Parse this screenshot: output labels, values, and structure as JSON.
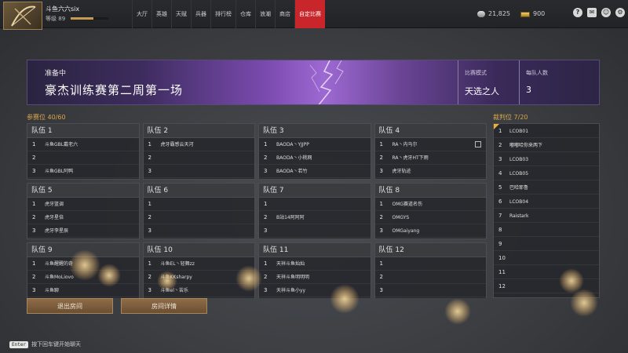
{
  "player": {
    "name": "斗鱼六六six",
    "level_label": "等级",
    "level_value": "89",
    "level_progress": 0.6
  },
  "nav": {
    "items": [
      "大厅",
      "英雄",
      "天赋",
      "兵器",
      "排行榜",
      "仓库",
      "浪潮",
      "商店",
      "自定比赛"
    ],
    "active_index": 8
  },
  "currency": {
    "silver": "21,825",
    "gold": "900"
  },
  "top_icons": [
    "help-icon",
    "mail-icon",
    "friends-icon",
    "settings-icon"
  ],
  "banner": {
    "status": "准备中",
    "title": "豪杰训练赛第二周第一场",
    "mode_label": "比赛模式",
    "mode_value": "天选之人",
    "team_size_label": "每队人数",
    "team_size_value": "3"
  },
  "participants": {
    "label": "参赛位",
    "count": "40/60"
  },
  "referees": {
    "label": "裁判位",
    "count": "7/20",
    "list": [
      {
        "num": "1",
        "name": "LCOB01"
      },
      {
        "num": "2",
        "name": "嘟嘟哈你来两下"
      },
      {
        "num": "3",
        "name": "LCOB03"
      },
      {
        "num": "4",
        "name": "LCOB05"
      },
      {
        "num": "5",
        "name": "巴哈耶鲁"
      },
      {
        "num": "6",
        "name": "LCOB04"
      },
      {
        "num": "7",
        "name": "Raistark"
      },
      {
        "num": "8",
        "name": ""
      },
      {
        "num": "9",
        "name": ""
      },
      {
        "num": "10",
        "name": ""
      },
      {
        "num": "11",
        "name": ""
      },
      {
        "num": "12",
        "name": ""
      }
    ]
  },
  "teams": [
    {
      "name": "队伍 1",
      "players": [
        {
          "num": "1",
          "name": "斗鱼GBL戴老六"
        },
        {
          "num": "2",
          "name": ""
        },
        {
          "num": "3",
          "name": "斗鱼GBL阿鸭"
        }
      ]
    },
    {
      "name": "队伍 2",
      "players": [
        {
          "num": "1",
          "name": "虎牙霸感云天河"
        },
        {
          "num": "2",
          "name": ""
        },
        {
          "num": "3",
          "name": ""
        }
      ]
    },
    {
      "name": "队伍 3",
      "players": [
        {
          "num": "1",
          "name": "BAODA丶YJJPP"
        },
        {
          "num": "2",
          "name": "BAODA丶小桃网"
        },
        {
          "num": "3",
          "name": "BAODA丶若竹"
        }
      ]
    },
    {
      "name": "队伍 4",
      "players": [
        {
          "num": "1",
          "name": "RA丶内马尔"
        },
        {
          "num": "2",
          "name": "RA丶虎牙HT下雨"
        },
        {
          "num": "3",
          "name": "虎牙轨迹"
        }
      ]
    },
    {
      "name": "队伍 5",
      "players": [
        {
          "num": "1",
          "name": "虎牙篮调"
        },
        {
          "num": "2",
          "name": "虎牙星倍"
        },
        {
          "num": "3",
          "name": "虎牙李星辰"
        }
      ]
    },
    {
      "name": "队伍 6",
      "players": [
        {
          "num": "1",
          "name": ""
        },
        {
          "num": "2",
          "name": ""
        },
        {
          "num": "3",
          "name": ""
        }
      ]
    },
    {
      "name": "队伍 7",
      "players": [
        {
          "num": "1",
          "name": ""
        },
        {
          "num": "2",
          "name": "B站14阿阿阿"
        },
        {
          "num": "3",
          "name": ""
        }
      ]
    },
    {
      "name": "队伍 8",
      "players": [
        {
          "num": "1",
          "name": "OMG赛道名伤"
        },
        {
          "num": "2",
          "name": "OMGYS"
        },
        {
          "num": "3",
          "name": "OMGaiyang"
        }
      ]
    },
    {
      "name": "队伍 9",
      "players": [
        {
          "num": "1",
          "name": "斗鱼醒醒的奇"
        },
        {
          "num": "2",
          "name": "斗鱼MoLiovo"
        },
        {
          "num": "3",
          "name": "斗鱼聊"
        }
      ]
    },
    {
      "name": "队伍 10",
      "players": [
        {
          "num": "1",
          "name": "斗鱼EL丶轻舞zz"
        },
        {
          "num": "2",
          "name": "斗鱼KKsharpy"
        },
        {
          "num": "3",
          "name": "斗鱼el丶苦乐"
        }
      ]
    },
    {
      "name": "队伍 11",
      "players": [
        {
          "num": "1",
          "name": "天祥斗鱼灿灿"
        },
        {
          "num": "2",
          "name": "天祥斗鱼明明明"
        },
        {
          "num": "3",
          "name": "天祥斗鱼小yy"
        }
      ]
    },
    {
      "name": "队伍 12",
      "players": [
        {
          "num": "1",
          "name": ""
        },
        {
          "num": "2",
          "name": ""
        },
        {
          "num": "3",
          "name": ""
        }
      ]
    }
  ],
  "buttons": {
    "exit": "退出房间",
    "details": "房间详情"
  },
  "hint": {
    "key": "Enter",
    "text": "按下回车键开始聊天"
  }
}
